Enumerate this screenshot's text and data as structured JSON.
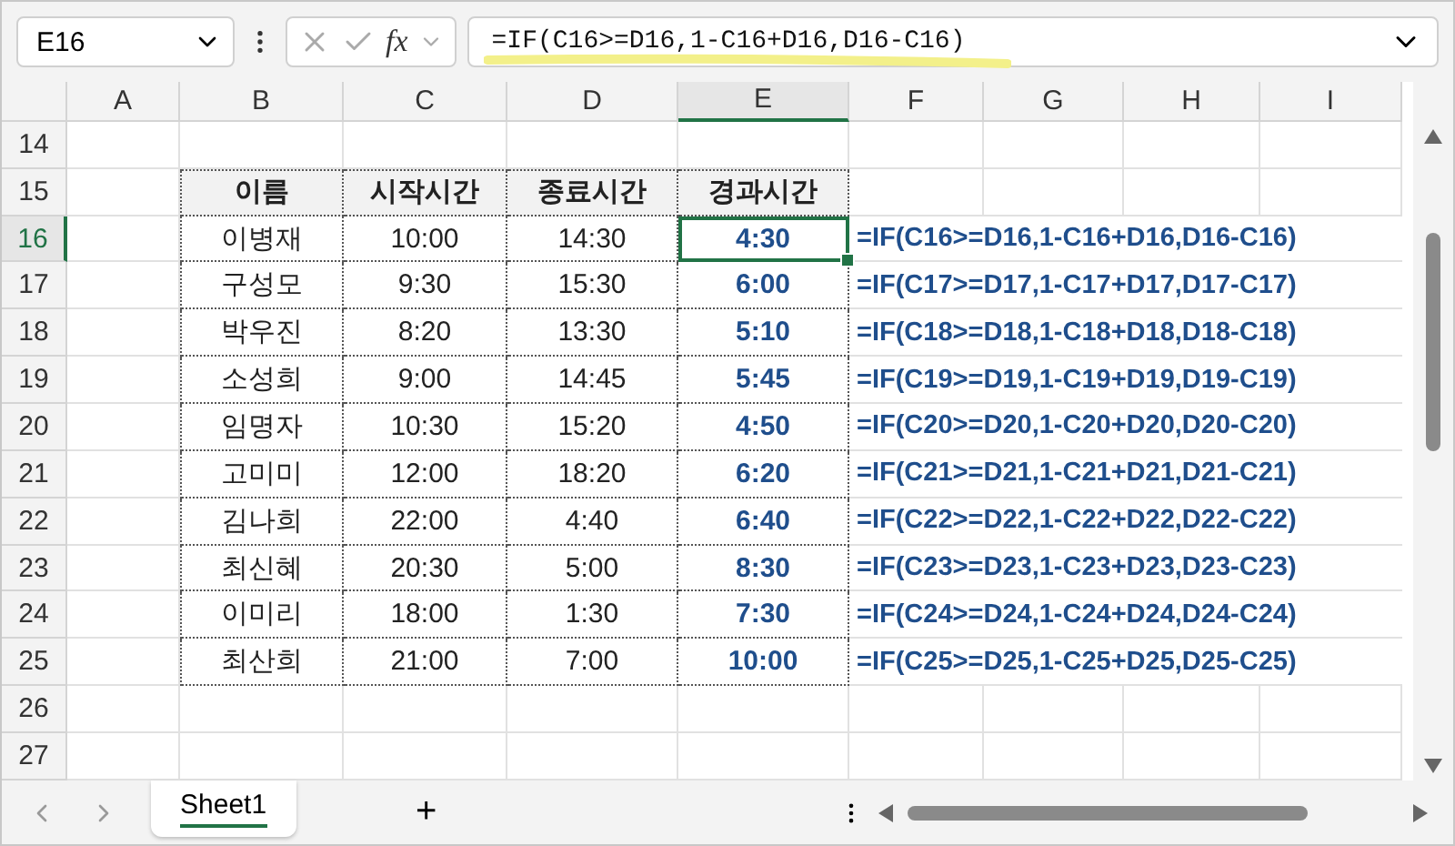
{
  "formula_bar": {
    "name_box": "E16",
    "function_label": "fx",
    "formula": "=IF(C16>=D16,1-C16+D16,D16-C16)"
  },
  "columns": [
    {
      "label": "A",
      "selected": false
    },
    {
      "label": "B",
      "selected": false
    },
    {
      "label": "C",
      "selected": false
    },
    {
      "label": "D",
      "selected": false
    },
    {
      "label": "E",
      "selected": true
    },
    {
      "label": "F",
      "selected": false
    },
    {
      "label": "G",
      "selected": false
    },
    {
      "label": "H",
      "selected": false
    },
    {
      "label": "I",
      "selected": false
    }
  ],
  "table": {
    "start_row": "15",
    "headers": [
      "이름",
      "시작시간",
      "종료시간",
      "경과시간"
    ],
    "rows": [
      {
        "row": "16",
        "name": "이병재",
        "start": "10:00",
        "end": "14:30",
        "elapsed": "4:30",
        "formula": "=IF(C16>=D16,1-C16+D16,D16-C16)",
        "selected": true
      },
      {
        "row": "17",
        "name": "구성모",
        "start": "9:30",
        "end": "15:30",
        "elapsed": "6:00",
        "formula": "=IF(C17>=D17,1-C17+D17,D17-C17)",
        "selected": false
      },
      {
        "row": "18",
        "name": "박우진",
        "start": "8:20",
        "end": "13:30",
        "elapsed": "5:10",
        "formula": "=IF(C18>=D18,1-C18+D18,D18-C18)",
        "selected": false
      },
      {
        "row": "19",
        "name": "소성희",
        "start": "9:00",
        "end": "14:45",
        "elapsed": "5:45",
        "formula": "=IF(C19>=D19,1-C19+D19,D19-C19)",
        "selected": false
      },
      {
        "row": "20",
        "name": "임명자",
        "start": "10:30",
        "end": "15:20",
        "elapsed": "4:50",
        "formula": "=IF(C20>=D20,1-C20+D20,D20-C20)",
        "selected": false
      },
      {
        "row": "21",
        "name": "고미미",
        "start": "12:00",
        "end": "18:20",
        "elapsed": "6:20",
        "formula": "=IF(C21>=D21,1-C21+D21,D21-C21)",
        "selected": false
      },
      {
        "row": "22",
        "name": "김나희",
        "start": "22:00",
        "end": "4:40",
        "elapsed": "6:40",
        "formula": "=IF(C22>=D22,1-C22+D22,D22-C22)",
        "selected": false
      },
      {
        "row": "23",
        "name": "최신혜",
        "start": "20:30",
        "end": "5:00",
        "elapsed": "8:30",
        "formula": "=IF(C23>=D23,1-C23+D23,D23-C23)",
        "selected": false
      },
      {
        "row": "24",
        "name": "이미리",
        "start": "18:00",
        "end": "1:30",
        "elapsed": "7:30",
        "formula": "=IF(C24>=D24,1-C24+D24,D24-C24)",
        "selected": false
      },
      {
        "row": "25",
        "name": "최산희",
        "start": "21:00",
        "end": "7:00",
        "elapsed": "10:00",
        "formula": "=IF(C25>=D25,1-C25+D25,D25-C25)",
        "selected": false
      }
    ]
  },
  "empty_rows_before": [
    "14"
  ],
  "empty_rows_after": [
    "26",
    "27"
  ],
  "sheet_tabs": [
    {
      "label": "Sheet1",
      "selected": true
    }
  ],
  "add_sheet": "+"
}
